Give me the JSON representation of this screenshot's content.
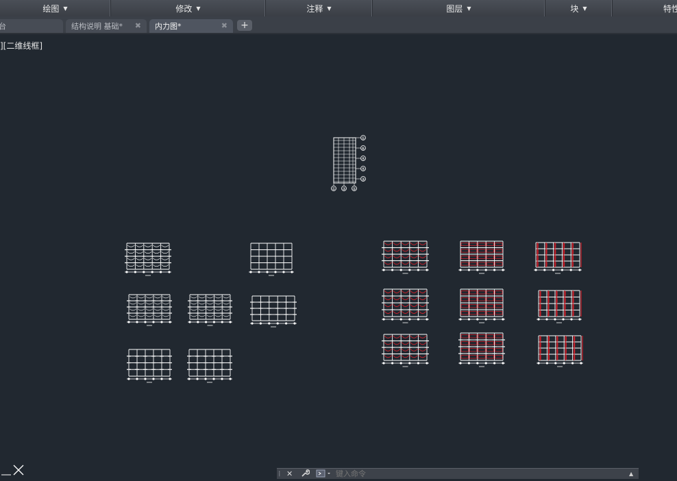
{
  "ribbon": {
    "panels": [
      {
        "label": "绘图",
        "arrow": "▼"
      },
      {
        "label": "修改",
        "arrow": "▼"
      },
      {
        "label": "注释",
        "arrow": "▼"
      },
      {
        "label": "图层",
        "arrow": "▼"
      },
      {
        "label": "块",
        "arrow": "▼"
      },
      {
        "label": "特性",
        "arrow": ""
      }
    ]
  },
  "tabs": [
    {
      "label": "台",
      "close": ""
    },
    {
      "label": "结构说明 基础*",
      "close": "✖"
    },
    {
      "label": "内力图*",
      "close": "✖"
    }
  ],
  "new_tab_symbol": "+",
  "viewport_label": "][二维线框]",
  "grid_labels": [
    "①",
    "⑥",
    "④",
    "④",
    "③",
    "①",
    "③",
    "⑤"
  ],
  "command": {
    "close_symbol": "✕",
    "wrench_icon": "wrench-icon",
    "placeholder": "键入命令"
  },
  "colors": {
    "background": "#212830",
    "drawing_white": "#ffffff",
    "drawing_red": "#d0202a"
  }
}
